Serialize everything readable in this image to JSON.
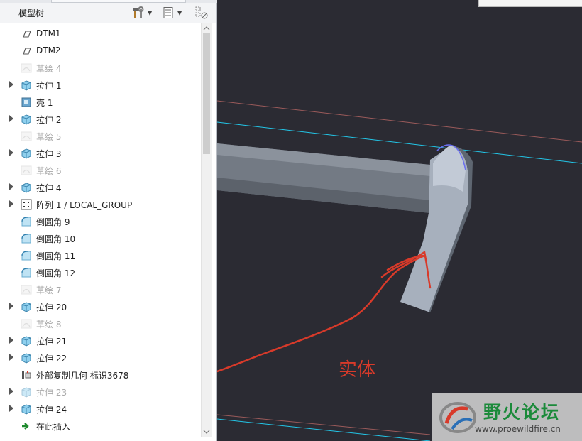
{
  "model_tree": {
    "title": "模型树",
    "items": [
      {
        "label": "DTM1",
        "icon": "datum-plane-icon",
        "expandable": false,
        "suppressed": false
      },
      {
        "label": "DTM2",
        "icon": "datum-plane-icon",
        "expandable": false,
        "suppressed": false
      },
      {
        "label": "草绘 4",
        "icon": "sketch-icon",
        "expandable": false,
        "suppressed": true
      },
      {
        "label": "拉伸 1",
        "icon": "extrude-icon",
        "expandable": true,
        "suppressed": false
      },
      {
        "label": "壳 1",
        "icon": "shell-icon",
        "expandable": false,
        "suppressed": false
      },
      {
        "label": "拉伸 2",
        "icon": "extrude-icon",
        "expandable": true,
        "suppressed": false
      },
      {
        "label": "草绘 5",
        "icon": "sketch-icon",
        "expandable": false,
        "suppressed": true
      },
      {
        "label": "拉伸 3",
        "icon": "extrude-icon",
        "expandable": true,
        "suppressed": false
      },
      {
        "label": "草绘 6",
        "icon": "sketch-icon",
        "expandable": false,
        "suppressed": true
      },
      {
        "label": "拉伸 4",
        "icon": "extrude-icon",
        "expandable": true,
        "suppressed": false
      },
      {
        "label": "阵列 1 / LOCAL_GROUP",
        "icon": "pattern-icon",
        "expandable": true,
        "suppressed": false
      },
      {
        "label": "倒圆角 9",
        "icon": "round-icon",
        "expandable": false,
        "suppressed": false
      },
      {
        "label": "倒圆角 10",
        "icon": "round-icon",
        "expandable": false,
        "suppressed": false
      },
      {
        "label": "倒圆角 11",
        "icon": "round-icon",
        "expandable": false,
        "suppressed": false
      },
      {
        "label": "倒圆角 12",
        "icon": "round-icon",
        "expandable": false,
        "suppressed": false
      },
      {
        "label": "草绘 7",
        "icon": "sketch-icon",
        "expandable": false,
        "suppressed": true
      },
      {
        "label": "拉伸 20",
        "icon": "extrude-icon",
        "expandable": true,
        "suppressed": false
      },
      {
        "label": "草绘 8",
        "icon": "sketch-icon",
        "expandable": false,
        "suppressed": true
      },
      {
        "label": "拉伸 21",
        "icon": "extrude-icon",
        "expandable": true,
        "suppressed": false
      },
      {
        "label": "拉伸 22",
        "icon": "extrude-icon",
        "expandable": true,
        "suppressed": false
      },
      {
        "label": "外部复制几何 标识3678",
        "icon": "external-copy-geometry-icon",
        "expandable": false,
        "suppressed": false
      },
      {
        "label": "拉伸 23",
        "icon": "extrude-icon",
        "expandable": true,
        "suppressed": true
      },
      {
        "label": "拉伸 24",
        "icon": "extrude-icon",
        "expandable": true,
        "suppressed": false
      },
      {
        "label": "在此插入",
        "icon": "insert-here-arrow-icon",
        "expandable": false,
        "suppressed": false
      }
    ]
  },
  "toolbar": {
    "tools_icon": "hammer-wrench-icon",
    "settings_icon": "tree-settings-icon",
    "filter_icon": "tree-filter-icon"
  },
  "annotation": {
    "label": "实体",
    "color": "#d83a2a"
  },
  "watermark": {
    "title": "野火论坛",
    "url": "www.proewildfire.cn"
  },
  "colors": {
    "viewport_bg": "#2b2b33",
    "datum_line_cyan": "#23c6e8",
    "datum_line_red": "#9a5a5a",
    "solid_gray": "#8d96a2",
    "suppressed_text": "#a8a8a8"
  }
}
